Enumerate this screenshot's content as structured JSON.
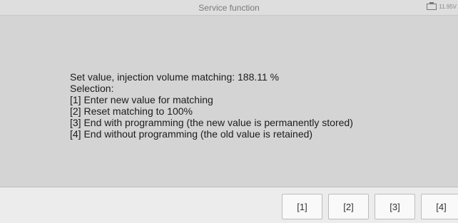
{
  "header": {
    "title": "Service function",
    "battery_voltage": "11.95V"
  },
  "message": {
    "lines": [
      "Set value, injection volume matching: 188.11 %",
      "Selection:",
      "[1] Enter new value for matching",
      "[2] Reset matching to 100%",
      "[3] End with programming (the new value is permanently stored)",
      "[4] End without programming (the old value is retained)"
    ]
  },
  "buttons": [
    {
      "label": "[1]"
    },
    {
      "label": "[2]"
    },
    {
      "label": "[3]"
    },
    {
      "label": "[4]"
    }
  ]
}
